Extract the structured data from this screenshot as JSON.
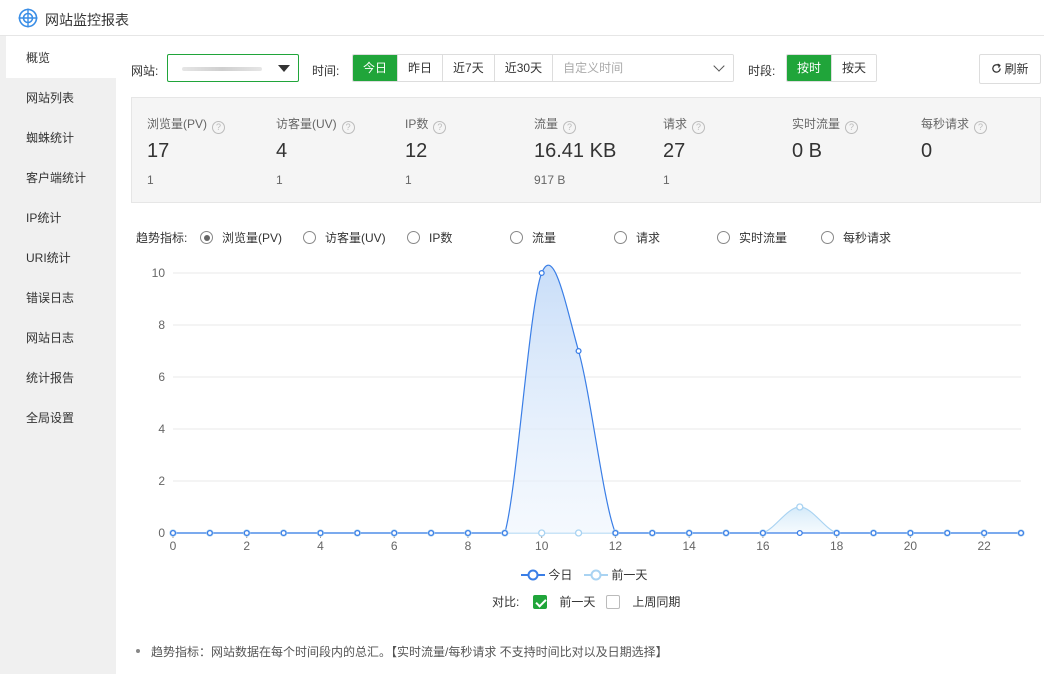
{
  "app": {
    "title": "网站监控报表"
  },
  "sidebar": {
    "items": [
      {
        "label": "概览",
        "active": true
      },
      {
        "label": "网站列表"
      },
      {
        "label": "蜘蛛统计"
      },
      {
        "label": "客户端统计"
      },
      {
        "label": "IP统计"
      },
      {
        "label": "URI统计"
      },
      {
        "label": "错误日志"
      },
      {
        "label": "网站日志"
      },
      {
        "label": "统计报告"
      },
      {
        "label": "全局设置"
      }
    ]
  },
  "filters": {
    "site_label": "网站:",
    "time_label": "时间:",
    "time_buttons": [
      "今日",
      "昨日",
      "近7天",
      "近30天"
    ],
    "time_selected": "今日",
    "custom_time_placeholder": "自定义时间",
    "period_label": "时段:",
    "period_buttons": [
      "按时",
      "按天"
    ],
    "period_selected": "按时",
    "refresh_label": "刷新"
  },
  "stats": [
    {
      "name": "浏览量(PV)",
      "value": "17",
      "prev": "1"
    },
    {
      "name": "访客量(UV)",
      "value": "4",
      "prev": "1"
    },
    {
      "name": "IP数",
      "value": "12",
      "prev": "1"
    },
    {
      "name": "流量",
      "value": "16.41 KB",
      "prev": "917 B"
    },
    {
      "name": "请求",
      "value": "27",
      "prev": "1"
    },
    {
      "name": "实时流量",
      "value": "0 B",
      "prev": ""
    },
    {
      "name": "每秒请求",
      "value": "0",
      "prev": ""
    }
  ],
  "trend": {
    "label": "趋势指标:",
    "options": [
      "浏览量(PV)",
      "访客量(UV)",
      "IP数",
      "流量",
      "请求",
      "实时流量",
      "每秒请求"
    ],
    "selected": "浏览量(PV)"
  },
  "chart_data": {
    "type": "area",
    "x": [
      0,
      1,
      2,
      3,
      4,
      5,
      6,
      7,
      8,
      9,
      10,
      11,
      12,
      13,
      14,
      15,
      16,
      17,
      18,
      19,
      20,
      21,
      22,
      23
    ],
    "xticks": [
      0,
      2,
      4,
      6,
      8,
      10,
      12,
      14,
      16,
      18,
      20,
      22
    ],
    "yticks": [
      0,
      2,
      4,
      6,
      8,
      10
    ],
    "ylim": [
      0,
      10
    ],
    "xlim": [
      0,
      23
    ],
    "series": [
      {
        "name": "今日",
        "color": "#3a7ee6",
        "values": [
          0,
          0,
          0,
          0,
          0,
          0,
          0,
          0,
          0,
          0,
          10,
          7,
          0,
          0,
          0,
          0,
          0,
          0,
          0,
          0,
          0,
          0,
          0,
          0
        ]
      },
      {
        "name": "前一天",
        "color": "#a9d3f2",
        "values": [
          0,
          0,
          0,
          0,
          0,
          0,
          0,
          0,
          0,
          0,
          0,
          0,
          0,
          0,
          0,
          0,
          0,
          1,
          0,
          0,
          0,
          0,
          0,
          0
        ]
      }
    ],
    "grid": true,
    "legend_position": "bottom"
  },
  "compare": {
    "label": "对比:",
    "options": [
      {
        "label": "前一天",
        "checked": true
      },
      {
        "label": "上周同期",
        "checked": false
      }
    ]
  },
  "note": "趋势指标：网站数据在每个时间段内的总汇。【实时流量/每秒请求 不支持时间比对以及日期选择】"
}
